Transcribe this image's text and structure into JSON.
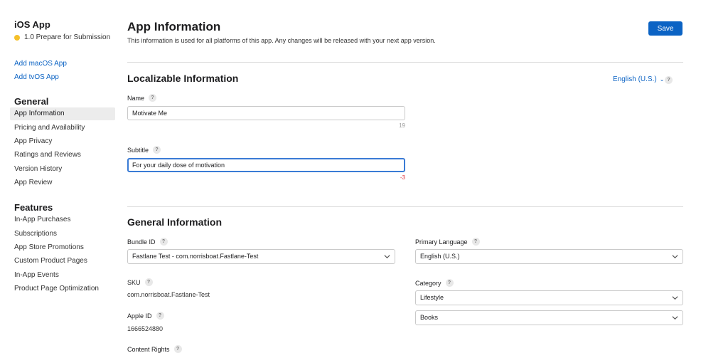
{
  "sidebar": {
    "app_title": "iOS App",
    "status": "1.0 Prepare for Submission",
    "status_color": "#f5c02a",
    "add_links": [
      "Add macOS App",
      "Add tvOS App"
    ],
    "general_heading": "General",
    "general_items": [
      "App Information",
      "Pricing and Availability",
      "App Privacy",
      "Ratings and Reviews",
      "Version History",
      "App Review"
    ],
    "active_item": "App Information",
    "features_heading": "Features",
    "feature_items": [
      "In-App Purchases",
      "Subscriptions",
      "App Store Promotions",
      "Custom Product Pages",
      "In-App Events",
      "Product Page Optimization"
    ]
  },
  "main": {
    "title": "App Information",
    "description": "This information is used for all platforms of this app. Any changes will be released with your next app version.",
    "save_label": "Save",
    "accent_color": "#0b63c4",
    "localizable": {
      "heading": "Localizable Information",
      "language": "English (U.S.)",
      "name_label": "Name",
      "name_value": "Motivate Me",
      "name_counter": "19",
      "subtitle_label": "Subtitle",
      "subtitle_value": "For your daily dose of motivation",
      "subtitle_counter": "-3",
      "error_color": "#e0303a"
    },
    "general": {
      "heading": "General Information",
      "bundle_label": "Bundle ID",
      "bundle_value": "Fastlane Test - com.norrisboat.Fastlane-Test",
      "sku_label": "SKU",
      "sku_value": "com.norrisboat.Fastlane-Test",
      "apple_id_label": "Apple ID",
      "apple_id_value": "1666524880",
      "content_rights_label": "Content Rights",
      "primary_language_label": "Primary Language",
      "primary_language_value": "English (U.S.)",
      "category_label": "Category",
      "category_primary": "Lifestyle",
      "category_secondary": "Books"
    },
    "help_glyph": "?"
  }
}
